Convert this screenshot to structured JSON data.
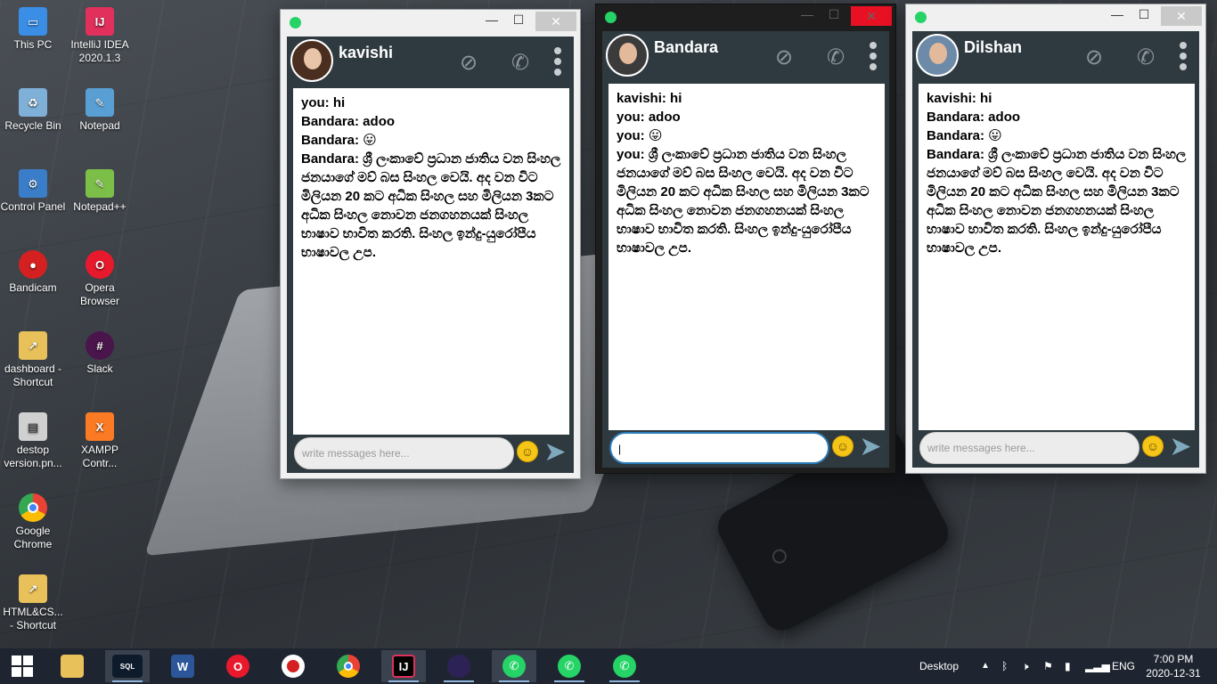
{
  "desktop": {
    "icons": [
      {
        "label": "This PC",
        "icon": "computer-icon",
        "color": "#3a8ee6"
      },
      {
        "label": "IntelliJ IDEA 2020.1.3",
        "icon": "intellij-icon",
        "color": "#e0305b"
      },
      {
        "label": "Recycle Bin",
        "icon": "recycle-bin-icon",
        "color": "#7fb0d8"
      },
      {
        "label": "Notepad",
        "icon": "notepad-icon",
        "color": "#5a9fd4"
      },
      {
        "label": "Control Panel",
        "icon": "control-panel-icon",
        "color": "#3a7ec9"
      },
      {
        "label": "Notepad++",
        "icon": "notepadpp-icon",
        "color": "#7cbf48"
      },
      {
        "label": "Bandicam",
        "icon": "bandicam-icon",
        "color": "#d42020"
      },
      {
        "label": "Opera Browser",
        "icon": "opera-icon",
        "color": "#e8192c"
      },
      {
        "label": "dashboard - Shortcut",
        "icon": "folder-shortcut-icon",
        "color": "#e8c15a"
      },
      {
        "label": "Slack",
        "icon": "slack-icon",
        "color": "#4a154b"
      },
      {
        "label": "destop version.pn...",
        "icon": "image-file-icon",
        "color": "#d0d0d0"
      },
      {
        "label": "XAMPP Contr...",
        "icon": "xampp-icon",
        "color": "#fb7a24"
      },
      {
        "label": "Google Chrome",
        "icon": "chrome-icon",
        "color": "#34a853"
      },
      {
        "label": "HTML&CS... - Shortcut",
        "icon": "folder-shortcut-icon",
        "color": "#e8c15a"
      }
    ]
  },
  "composer_placeholder": "write messages here...",
  "windows": [
    {
      "contact": "kavishi",
      "messages": [
        "you: hi",
        "Bandara: adoo",
        "Bandara: 😛",
        "Bandara: ශ්‍රී ලංකාවේ ප්‍රධාන ජාතිය වන සිංහල ජනයාගේ මව් බස සිංහල වෙයි. අද වන විට මිලියන 20 කට අධික සිංහල සහ මිලියන 3කට අධික සිංහල නොවන ජනගහනයක් සිංහල භාෂාව භාවිත කරති. සිංහල ඉන්දු-යුරෝපීය භාෂාවල උප."
      ]
    },
    {
      "contact": "Bandara",
      "messages": [
        "kavishi: hi",
        "you: adoo",
        "you: 😛",
        "you: ශ්‍රී ලංකාවේ ප්‍රධාන ජාතිය වන සිංහල ජනයාගේ මව් බස සිංහල වෙයි. අද වන විට මිලියන 20 කට අධික සිංහල සහ මිලියන 3කට අධික සිංහල නොවන ජනගහනයක් සිංහල භාෂාව භාවිත කරති. සිංහල ඉන්දු-යුරෝපීය භාෂාවල උප."
      ]
    },
    {
      "contact": "Dilshan",
      "messages": [
        "kavishi: hi",
        "Bandara: adoo",
        "Bandara: 😛",
        "Bandara: ශ්‍රී ලංකාවේ ප්‍රධාන ජාතිය වන සිංහල ජනයාගේ මව් බස සිංහල වෙයි. අද වන විට මිලියන 20 කට අධික සිංහල සහ මිලියන 3කට අධික සිංහල නොවන ජනගහනයක් සිංහල භාෂාව භාවිත කරති. සිංහල ඉන්දු-යුරෝපීය භාෂාවල උප."
      ]
    }
  ],
  "taskbar": {
    "apps": [
      "start-icon",
      "file-explorer-icon",
      "mysql-icon",
      "word-icon",
      "opera-icon",
      "bandicam-icon",
      "chrome-icon",
      "intellij-icon",
      "eclipse-icon",
      "whatsapp-icon",
      "whatsapp-icon",
      "whatsapp-icon"
    ],
    "desktop_label": "Desktop",
    "language": "ENG",
    "time": "7:00 PM",
    "date": "2020-12-31"
  }
}
